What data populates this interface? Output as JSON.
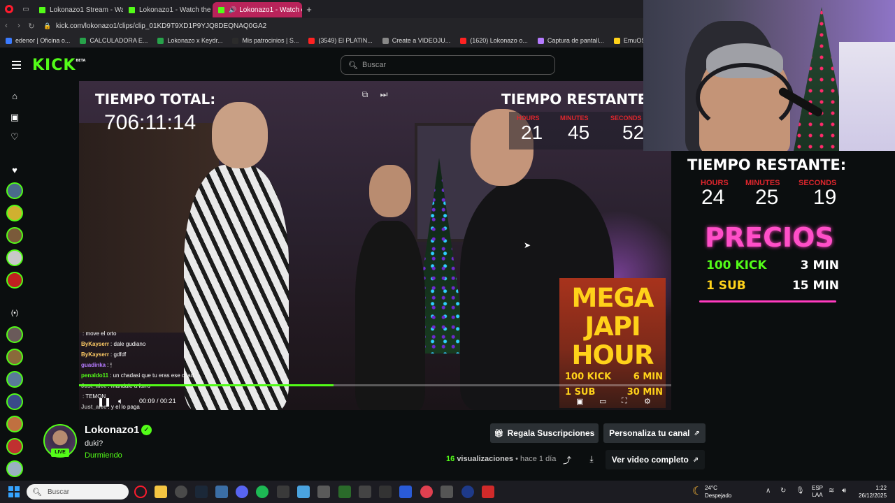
{
  "browser": {
    "tabs": [
      {
        "label": "Lokonazo1 Stream - Watch",
        "active": false
      },
      {
        "label": "Lokonazo1 - Watch the VOD",
        "active": false
      },
      {
        "label": "Lokonazo1 - Watch clip",
        "active": true
      }
    ],
    "url": "kick.com/lokonazo1/clips/clip_01KD9T9XD1P9YJQ8DEQNAQ0GA2",
    "bookmarks": [
      {
        "label": "edenor | Oficina o...",
        "color": "#3b7bff"
      },
      {
        "label": "CALCULADORA E...",
        "color": "#27a24a"
      },
      {
        "label": "Lokonazo x Keydr...",
        "color": "#27a24a"
      },
      {
        "label": "Mis patrocinios | S...",
        "color": "#2b2b2b"
      },
      {
        "label": "(3549) El PLATIN...",
        "color": "#ff2222"
      },
      {
        "label": "Create a VIDEOJU...",
        "color": "#888888"
      },
      {
        "label": "(1620) Lokonazo o...",
        "color": "#ff2222"
      },
      {
        "label": "Captura de pantall...",
        "color": "#b57bff"
      },
      {
        "label": "EmuOS v1.0",
        "color": "#ffd21a"
      }
    ]
  },
  "kick": {
    "logo": "KICK",
    "logo_badge": "BETA",
    "search_placeholder": "Buscar"
  },
  "video": {
    "overlay_total_title": "TIEMPO TOTAL:",
    "overlay_total_value": "706:11:14",
    "overlay_rest_title": "TIEMPO RESTANTE",
    "overlay_units": [
      "HOURS",
      "MINUTES",
      "SECONDS"
    ],
    "overlay_values": [
      "21",
      "45",
      "52"
    ],
    "mega_lines": [
      "MEGA",
      "JAPI",
      "HOUR"
    ],
    "mega_rows": [
      {
        "left": "100 KICK",
        "right": "6 MIN"
      },
      {
        "left": "1 SUB",
        "right": "30 MIN"
      }
    ],
    "chat": [
      {
        "user": "",
        "user_color": "#ff5555",
        "text": ": move el orto"
      },
      {
        "user": "ByKayserr",
        "user_color": "#ffcc66",
        "text": ": dale gudiano"
      },
      {
        "user": "ByKayserr",
        "user_color": "#ffcc66",
        "text": ": gdfdf"
      },
      {
        "user": "guadinka",
        "user_color": "#b57bff",
        "text": ": 🕯"
      },
      {
        "user": "penaldo11",
        "user_color": "#53fc18",
        "text": ": un chadasi que tu eras ese chad"
      },
      {
        "user": "Just_alee",
        "user_color": "#aaaaaa",
        "text": ": mandale a farro"
      },
      {
        "user": "",
        "user_color": "#ff5555",
        "text": ": TEMON"
      },
      {
        "user": "Just_alee",
        "user_color": "#aaaaaa",
        "text": ": y el lo paga"
      }
    ],
    "current_time": "00:09",
    "duration": "00:21",
    "progress": 0.43
  },
  "stream_overlay": {
    "rest_title": "TIEMPO RESTANTE:",
    "units": [
      "HOURS",
      "MINUTES",
      "SECONDS"
    ],
    "values": [
      "24",
      "25",
      "19"
    ],
    "precios_title": "PRECIOS",
    "price_rows": [
      {
        "left": "100 KICK",
        "right": "3 MIN",
        "color": "#53fc18"
      },
      {
        "left": "1 SUB",
        "right": "15 MIN",
        "color": "#ffd21a"
      }
    ]
  },
  "channel": {
    "name": "Lokonazo1",
    "live_badge": "LIVE",
    "clip_title": "duki?",
    "category": "Durmiendo",
    "gift_button": "Regala Suscripciones",
    "customize_button": "Personaliza tu canal",
    "views_count": "16",
    "views_label": "visualizaciones",
    "dot": "•",
    "time_ago": "hace 1 día",
    "full_video_button": "Ver video completo"
  },
  "taskbar": {
    "search_placeholder": "Buscar",
    "weather_temp": "24°C",
    "weather_desc": "Despejado",
    "lang_1": "ESP",
    "lang_2": "LAA",
    "time": "1:22",
    "date": "26/12/2025"
  },
  "colors": {
    "kick_green": "#53fc18",
    "tab_active": "#b8235a",
    "overlay_red": "#e0262d",
    "precios_pink": "#ff4fc8",
    "mega_yellow": "#ffd21a"
  }
}
